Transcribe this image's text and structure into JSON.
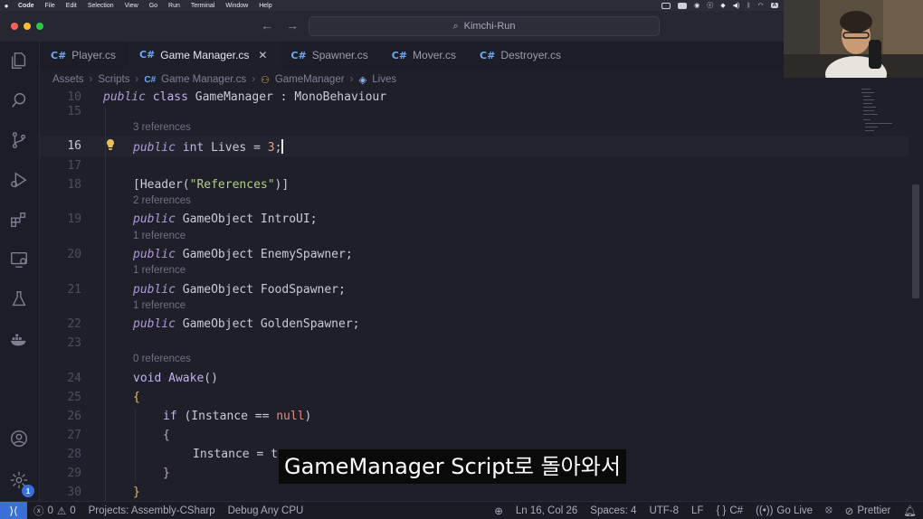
{
  "menubar": {
    "app": "Code",
    "items": [
      "File",
      "Edit",
      "Selection",
      "View",
      "Go",
      "Run",
      "Terminal",
      "Window",
      "Help"
    ],
    "input_badge": "A"
  },
  "titlebar": {
    "search": "Kimchi-Run"
  },
  "tabs": [
    {
      "label": "Player.cs",
      "icon": "csharp-icon"
    },
    {
      "label": "Game Manager.cs",
      "icon": "csharp-icon",
      "active": true
    },
    {
      "label": "Spawner.cs",
      "icon": "csharp-icon"
    },
    {
      "label": "Mover.cs",
      "icon": "csharp-icon"
    },
    {
      "label": "Destroyer.cs",
      "icon": "csharp-icon"
    }
  ],
  "breadcrumb": [
    "Assets",
    "Scripts",
    "Game Manager.cs",
    "GameManager",
    "Lives"
  ],
  "editor": {
    "line_numbers": [
      "10",
      "15",
      "16",
      "17",
      "18",
      "19",
      "20",
      "21",
      "22",
      "23",
      "24",
      "25",
      "26",
      "27",
      "28",
      "29",
      "30"
    ],
    "lens": [
      "3 references",
      "2 references",
      "1 reference",
      "1 reference",
      "1 reference",
      "0 references"
    ],
    "tokens": {
      "public": "public",
      "class": "class",
      "int": "int",
      "void": "void",
      "if": "if",
      "GameManager": "GameManager",
      "colon": " : ",
      "MonoBehaviour": "MonoBehaviour",
      "Lives": " Lives = ",
      "three": "3",
      "semi": ";",
      "header_open": "[Header(",
      "references_str": "\"References\"",
      "header_close": ")]",
      "GameObject": "GameObject",
      "IntroUI": " IntroUI;",
      "EnemySpawner": " EnemySpawner;",
      "FoodSpawner": " FoodSpawner;",
      "GoldenSpawner": " GoldenSpawner;",
      "Awake": "Awake",
      "parens": "()",
      "brace_open": "{",
      "brace_close": "}",
      "if_cond": " (Instance == ",
      "null": "null",
      "close_paren": ")",
      "instance_assign": "Instance = t"
    }
  },
  "subtitle": "GameManager Script로 돌아와서",
  "status": {
    "remote_icon": "remote-icon",
    "errors": "0",
    "warnings": "0",
    "projects": "Projects: Assembly-CSharp",
    "debug": "Debug Any CPU",
    "position": "Ln 16, Col 26",
    "spaces": "Spaces: 4",
    "encoding": "UTF-8",
    "eol": "LF",
    "language": "C#",
    "golive": "Go Live",
    "prettier": "Prettier"
  },
  "activity_badge": "1",
  "colors": {
    "accent": "#3b6fd8",
    "editor_bg": "#1e1f29",
    "keyword": "#b29bd8",
    "number": "#f0a069",
    "string": "#b5cf8a"
  }
}
